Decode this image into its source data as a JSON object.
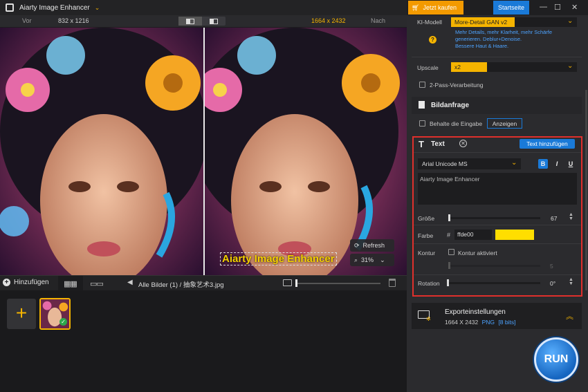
{
  "app": {
    "title": "Aiarty Image Enhancer"
  },
  "compare": {
    "before_label": "Vor",
    "before_size": "832 x 1216",
    "after_size": "1664 x 2432",
    "after_label": "Nach"
  },
  "preview": {
    "watermark_text": "Aiarty Image Enhancer",
    "refresh_label": "Refresh",
    "zoom": "31%"
  },
  "bottom_bar": {
    "add_label": "Hinzufügen",
    "breadcrumb": "Alle Bilder (1)  /  抽象艺术3.jpg"
  },
  "header_actions": {
    "buy_label": "Jetzt kaufen",
    "home_label": "Startseite"
  },
  "settings": {
    "ki_model_label": "KI-Modell",
    "ki_model_value": "More-Detail GAN v2",
    "ki_hint": [
      "Mehr Details, mehr Klarheit, mehr Schärfe",
      "generieren. Deblur+Denoise.",
      "Bessere Haut & Haare."
    ],
    "upscale_label": "Upscale",
    "upscale_value": "x2",
    "two_pass_label": "2-Pass-Verarbeitung"
  },
  "bildanfrage": {
    "title": "Bildanfrage",
    "keep_input_label": "Behalte die Eingabe",
    "show_button": "Anzeigen"
  },
  "text_panel": {
    "title": "Text",
    "add_button": "Text hinzufügen",
    "font": "Arial Unicode MS",
    "bold": "B",
    "italic": "I",
    "underline": "U",
    "content": "Aiarty Image Enhancer",
    "size_label": "Größe",
    "size_value": "67",
    "color_label": "Farbe",
    "color_hex": "ffde00",
    "color_swatch": "#ffde00",
    "outline_label": "Kontur",
    "outline_enable_label": "Kontur aktiviert",
    "outline_value": "5",
    "rotation_label": "Rotation",
    "rotation_value": "0°"
  },
  "export": {
    "title": "Exporteinstellungen",
    "size": "1664 X 2432",
    "format": "PNG",
    "bits": "[8 bits]"
  },
  "run_label": "RUN"
}
